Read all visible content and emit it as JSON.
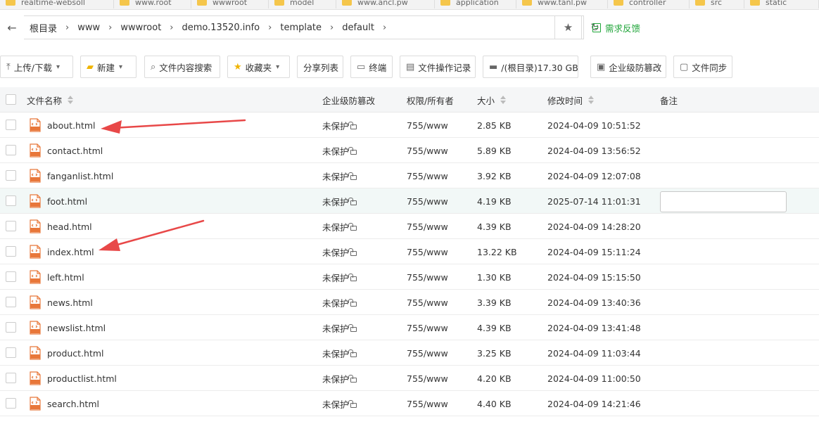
{
  "folder_tabs": [
    "realtime-websoll",
    "www.root",
    "wwwroot",
    "model",
    "www.ancl.pw",
    "application",
    "www.tanl.pw",
    "controller",
    "src",
    "static"
  ],
  "breadcrumb": {
    "items": [
      "根目录",
      "www",
      "wwwroot",
      "demo.13520.info",
      "template",
      "default"
    ],
    "feedback_label": "需求反馈"
  },
  "toolbar": {
    "upload_download": "上传/下载",
    "new": "新建",
    "content_search": "文件内容搜索",
    "favorites": "收藏夹",
    "share_list": "分享列表",
    "terminal": "终端",
    "op_log": "文件操作记录",
    "disk": "/(根目录)17.30 GB",
    "tamper": "企业级防篡改",
    "sync": "文件同步"
  },
  "table": {
    "headers": {
      "name": "文件名称",
      "protection": "企业级防篡改",
      "permission": "权限/所有者",
      "size": "大小",
      "mtime": "修改时间",
      "note": "备注"
    },
    "rows": [
      {
        "name": "about.html",
        "protection": "未保护",
        "permission": "755/www",
        "size": "2.85 KB",
        "mtime": "2024-04-09 10:51:52"
      },
      {
        "name": "contact.html",
        "protection": "未保护",
        "permission": "755/www",
        "size": "5.89 KB",
        "mtime": "2024-04-09 13:56:52"
      },
      {
        "name": "fanganlist.html",
        "protection": "未保护",
        "permission": "755/www",
        "size": "3.92 KB",
        "mtime": "2024-04-09 12:07:08"
      },
      {
        "name": "foot.html",
        "protection": "未保护",
        "permission": "755/www",
        "size": "4.19 KB",
        "mtime": "2025-07-14 11:01:31"
      },
      {
        "name": "head.html",
        "protection": "未保护",
        "permission": "755/www",
        "size": "4.39 KB",
        "mtime": "2024-04-09 14:28:20"
      },
      {
        "name": "index.html",
        "protection": "未保护",
        "permission": "755/www",
        "size": "13.22 KB",
        "mtime": "2024-04-09 15:11:24"
      },
      {
        "name": "left.html",
        "protection": "未保护",
        "permission": "755/www",
        "size": "1.30 KB",
        "mtime": "2024-04-09 15:15:50"
      },
      {
        "name": "news.html",
        "protection": "未保护",
        "permission": "755/www",
        "size": "3.39 KB",
        "mtime": "2024-04-09 13:40:36"
      },
      {
        "name": "newslist.html",
        "protection": "未保护",
        "permission": "755/www",
        "size": "4.39 KB",
        "mtime": "2024-04-09 13:41:48"
      },
      {
        "name": "product.html",
        "protection": "未保护",
        "permission": "755/www",
        "size": "3.25 KB",
        "mtime": "2024-04-09 11:03:44"
      },
      {
        "name": "productlist.html",
        "protection": "未保护",
        "permission": "755/www",
        "size": "4.20 KB",
        "mtime": "2024-04-09 11:00:50"
      },
      {
        "name": "search.html",
        "protection": "未保护",
        "permission": "755/www",
        "size": "4.40 KB",
        "mtime": "2024-04-09 14:21:46"
      }
    ]
  },
  "colors": {
    "accent_green": "#20a53a",
    "annotation_arrow": "#e84848",
    "file_icon": "#e8773a",
    "row_highlight": "#f2f8f7"
  }
}
